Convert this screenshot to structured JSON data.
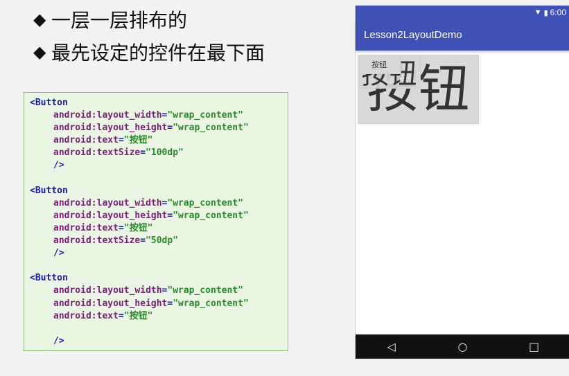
{
  "slide": {
    "bullet_symbol": "◆",
    "bullets": [
      "一层一层排布的",
      "最先设定的控件在最下面"
    ]
  },
  "code": {
    "tag_open": "<Button",
    "ns": "android",
    "attr_width": "layout_width",
    "attr_height": "layout_height",
    "attr_text": "text",
    "attr_textsize": "textSize",
    "val_wrap": "\"wrap_content\"",
    "val_text": "\"按钮\"",
    "val_size_100": "\"100dp\"",
    "val_size_50": "\"50dp\"",
    "close": "/>"
  },
  "phone": {
    "time": "6:00",
    "app_title": "Lesson2LayoutDemo",
    "button_large_label": "按钮",
    "button_medium_label": "按钮",
    "button_small_label": "按钮",
    "nav_back": "◁",
    "nav_home": "○",
    "nav_recent": "□"
  },
  "colors": {
    "app_bar": "#3f51b5",
    "code_bg": "#eaf6e3",
    "code_border": "#8fc27a"
  }
}
